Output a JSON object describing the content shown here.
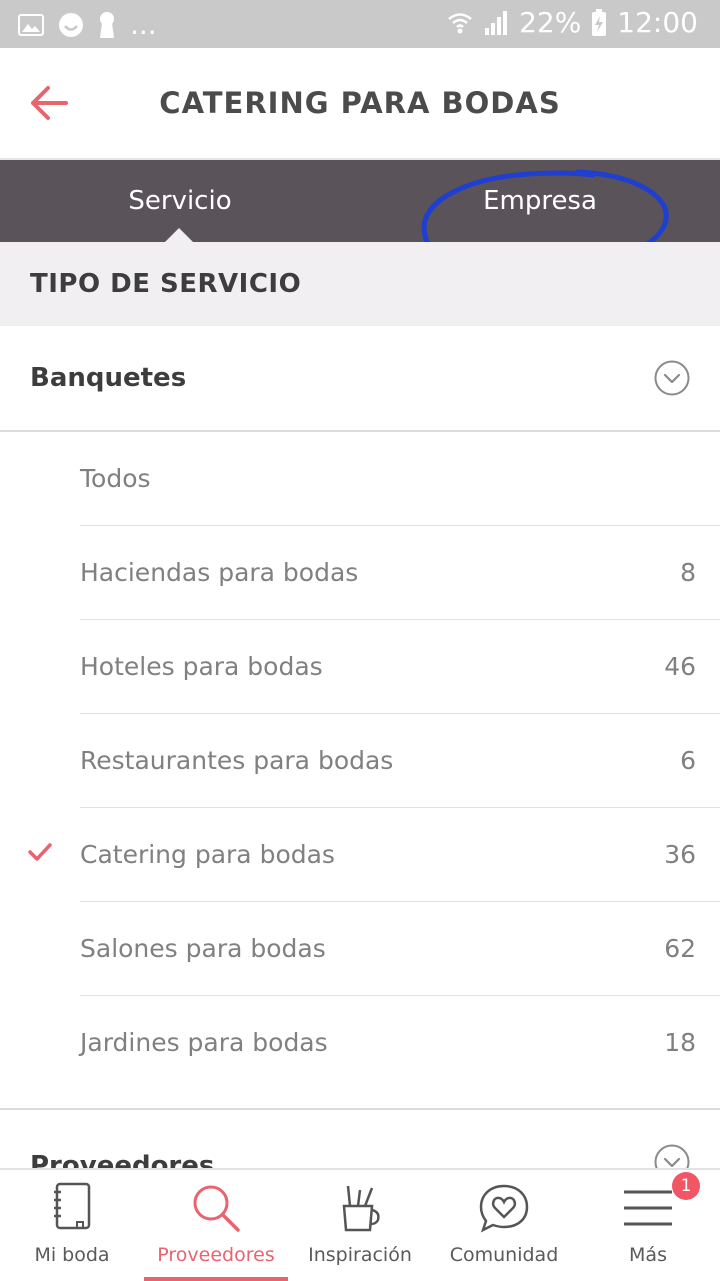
{
  "status_bar": {
    "battery": "22%",
    "time": "12:00",
    "overflow": "..."
  },
  "header": {
    "title": "CATERING PARA BODAS",
    "back_icon": "arrow-left-icon",
    "accent_color": "#e8646e"
  },
  "tabs": [
    {
      "label": "Servicio",
      "selected": true
    },
    {
      "label": "Empresa",
      "selected": false
    }
  ],
  "section": {
    "title": "TIPO DE SERVICIO"
  },
  "groups": [
    {
      "label": "Banquetes",
      "expanded": true,
      "items": [
        {
          "label": "Todos",
          "count": "",
          "checked": false
        },
        {
          "label": "Haciendas para bodas",
          "count": "8",
          "checked": false
        },
        {
          "label": "Hoteles para bodas",
          "count": "46",
          "checked": false
        },
        {
          "label": "Restaurantes para bodas",
          "count": "6",
          "checked": false
        },
        {
          "label": "Catering para bodas",
          "count": "36",
          "checked": true
        },
        {
          "label": "Salones para bodas",
          "count": "62",
          "checked": false
        },
        {
          "label": "Jardines para bodas",
          "count": "18",
          "checked": false
        }
      ]
    },
    {
      "label": "Proveedores",
      "expanded": false
    }
  ],
  "bottom_nav": [
    {
      "label": "Mi boda",
      "icon": "notebook-icon",
      "active": false
    },
    {
      "label": "Proveedores",
      "icon": "search-icon",
      "active": true
    },
    {
      "label": "Inspiración",
      "icon": "pencil-cup-icon",
      "active": false
    },
    {
      "label": "Comunidad",
      "icon": "heart-bubble-icon",
      "active": false
    },
    {
      "label": "Más",
      "icon": "menu-icon",
      "active": false,
      "badge": "1"
    }
  ]
}
